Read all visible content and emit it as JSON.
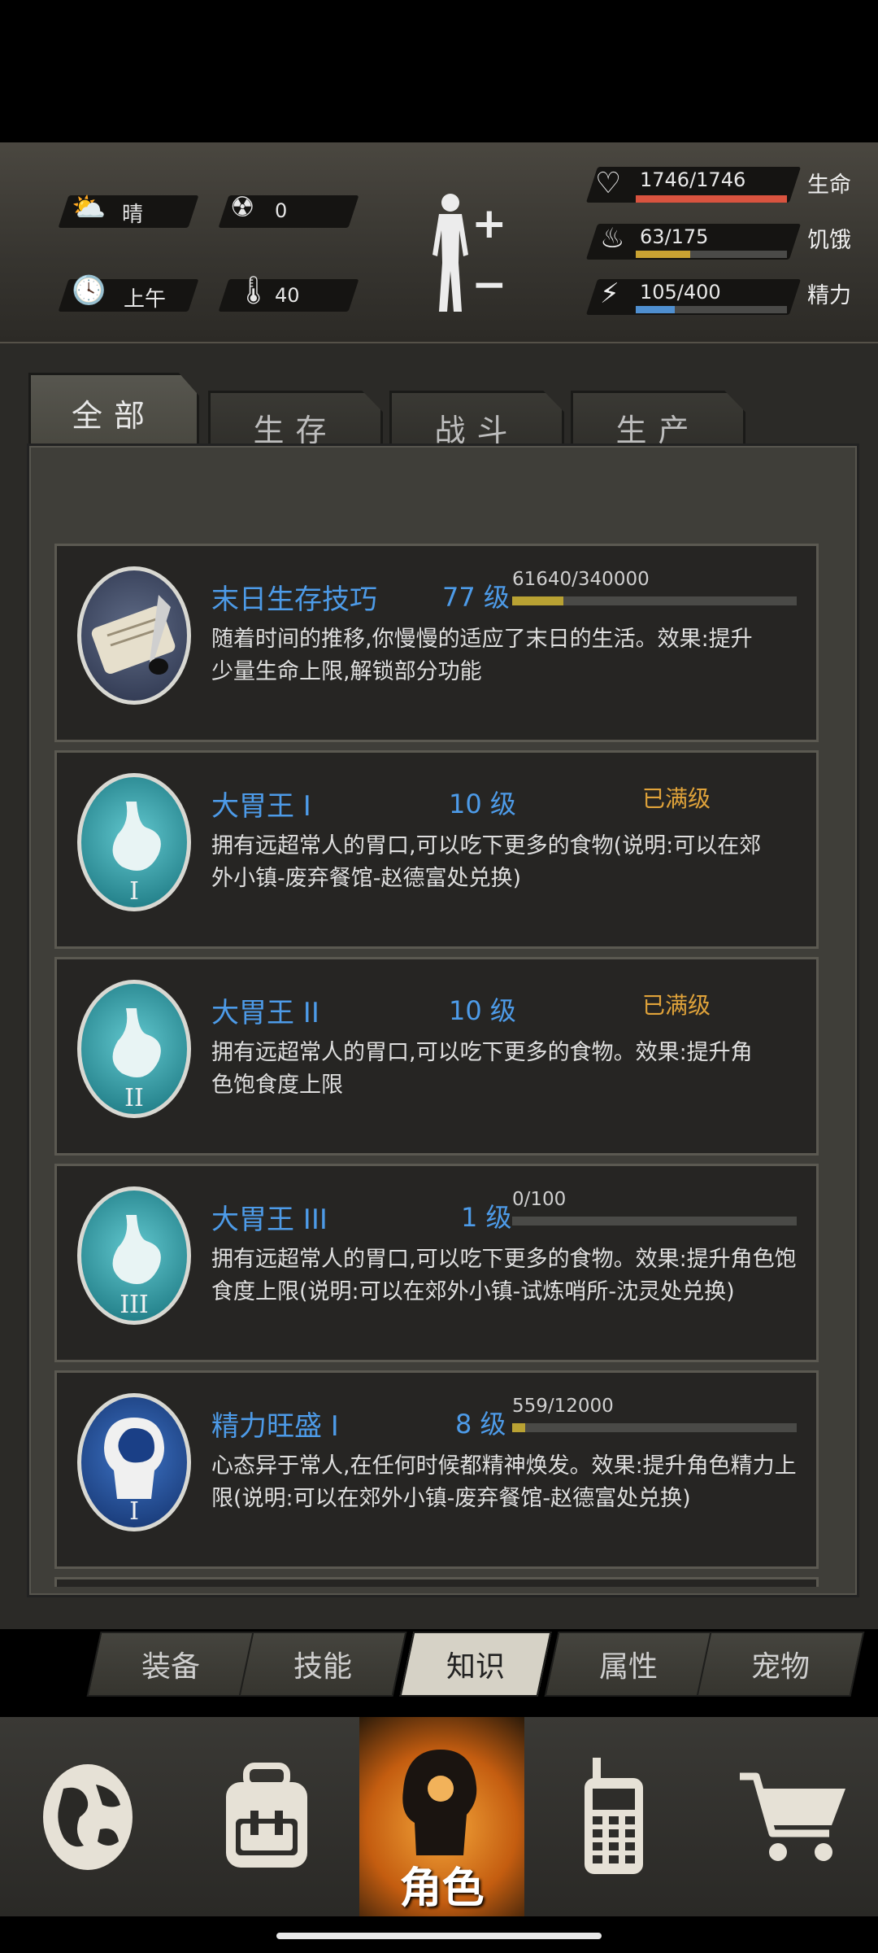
{
  "status": {
    "weather": "晴",
    "radiation": "0",
    "time_of_day": "上午",
    "temperature": "40",
    "health": {
      "label": "生命",
      "text": "1746/1746",
      "fraction": 1.0,
      "color": "#d9533f"
    },
    "hunger": {
      "label": "饥饿",
      "text": "63/175",
      "fraction": 0.36,
      "color": "#c9a232"
    },
    "energy": {
      "label": "精力",
      "text": "105/400",
      "fraction": 0.26,
      "color": "#4f8fd0"
    }
  },
  "tabs": [
    "全部",
    "生存",
    "战斗",
    "生产"
  ],
  "skills": [
    {
      "name": "末日生存技巧",
      "level": "77 级",
      "progress_text": "61640/340000",
      "progress": 0.181,
      "maxed": "",
      "desc": "随着时间的推移,你慢慢的适应了末日的生活。效果:提升少量生命上限,解锁部分功能",
      "icon": "scroll-quill-icon"
    },
    {
      "name": "大胃王 I",
      "level": "10 级",
      "progress_text": "",
      "progress": null,
      "maxed": "已满级",
      "desc": "拥有远超常人的胃口,可以吃下更多的食物(说明:可以在郊外小镇-废弃餐馆-赵德富处兑换)",
      "icon": "stomach-1-icon",
      "numeral": "I"
    },
    {
      "name": "大胃王 II",
      "level": "10 级",
      "progress_text": "",
      "progress": null,
      "maxed": "已满级",
      "desc": "拥有远超常人的胃口,可以吃下更多的食物。效果:提升角色饱食度上限",
      "icon": "stomach-2-icon",
      "numeral": "II"
    },
    {
      "name": "大胃王 III",
      "level": "1 级",
      "progress_text": "0/100",
      "progress": 0.0,
      "maxed": "",
      "desc": "拥有远超常人的胃口,可以吃下更多的食物。效果:提升角色饱食度上限(说明:可以在郊外小镇-试炼哨所-沈灵处兑换)",
      "icon": "stomach-3-icon",
      "numeral": "III"
    },
    {
      "name": "精力旺盛 I",
      "level": "8 级",
      "progress_text": "559/12000",
      "progress": 0.047,
      "maxed": "",
      "desc": "心态异于常人,在任何时候都精神焕发。效果:提升角色精力上限(说明:可以在郊外小镇-废弃餐馆-赵德富处兑换)",
      "icon": "brain-head-icon",
      "numeral": "I"
    }
  ],
  "sub_tabs": [
    "装备",
    "技能",
    "知识",
    "属性",
    "宠物"
  ],
  "bottom_nav": {
    "character_label": "角色"
  }
}
